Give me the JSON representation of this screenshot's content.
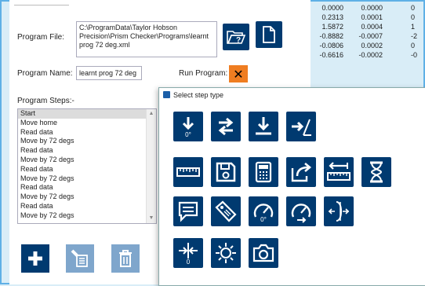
{
  "main": {
    "program_file_label": "Program File:",
    "program_file_path": "C:\\ProgramData\\Taylor Hobson Precision\\Prism Checker\\Programs\\learnt prog 72 deg.xml",
    "program_name_label": "Program Name:",
    "program_name_value": "learnt prog 72 deg",
    "run_program_label": "Run Program:",
    "program_steps_label": "Program Steps:-",
    "steps": [
      "Start",
      "Move home",
      "Read data",
      "Move by 72 degs",
      "Read data",
      "Move by 72 degs",
      "Read data",
      "Move by 72 degs",
      "Read data",
      "Move by 72 degs",
      "Read data",
      "Move by 72 degs"
    ]
  },
  "table": {
    "rows": [
      [
        "0.0000",
        "0.0000",
        "0"
      ],
      [
        "0.2313",
        "0.0001",
        "0"
      ],
      [
        "1.5872",
        "0.0004",
        "1"
      ],
      [
        "-0.8882",
        "-0.0007",
        "-2"
      ],
      [
        "-0.0806",
        "0.0002",
        "0"
      ],
      [
        "-0.6616",
        "-0.0002",
        "-0"
      ]
    ]
  },
  "dialog": {
    "title": "Select step type",
    "zero_label": "0°",
    "zero_small": "0"
  },
  "colors": {
    "accent": "#003a70",
    "run": "#ef7d21",
    "disabled": "#7fa6cc",
    "frame": "#5fb0e6"
  }
}
